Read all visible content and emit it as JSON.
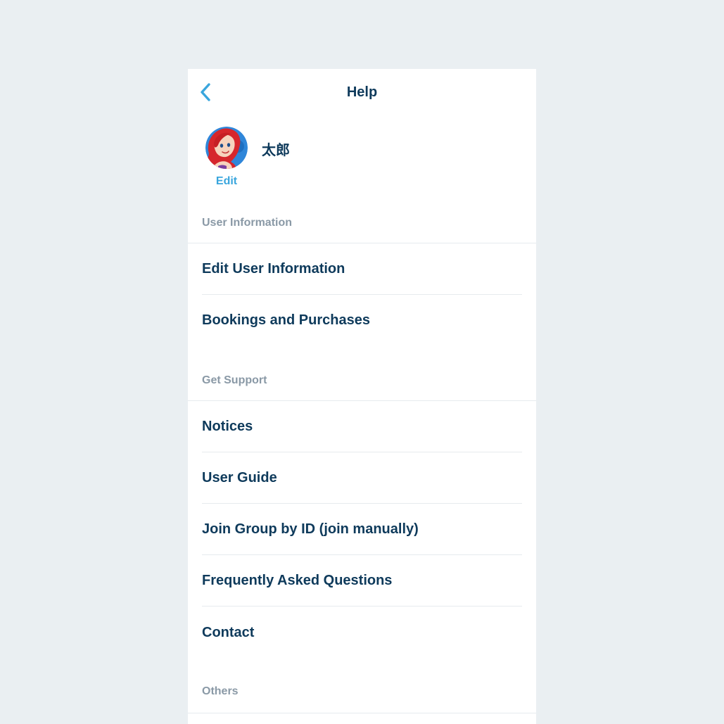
{
  "header": {
    "title": "Help",
    "back_icon": "chevron-left-icon"
  },
  "profile": {
    "name": "太郎",
    "edit_label": "Edit",
    "avatar": "avatar-image"
  },
  "colors": {
    "background": "#eaeff2",
    "panel": "#ffffff",
    "primary_text": "#0e3a5b",
    "accent": "#3aa6dd",
    "section_text": "#8a99a6",
    "divider": "#e6ebee"
  },
  "sections": [
    {
      "title": "User Information",
      "items": [
        "Edit User Information",
        "Bookings and Purchases"
      ]
    },
    {
      "title": "Get Support",
      "items": [
        "Notices",
        "User Guide",
        "Join Group by ID (join manually)",
        "Frequently Asked Questions",
        "Contact"
      ]
    },
    {
      "title": "Others",
      "items": []
    }
  ]
}
